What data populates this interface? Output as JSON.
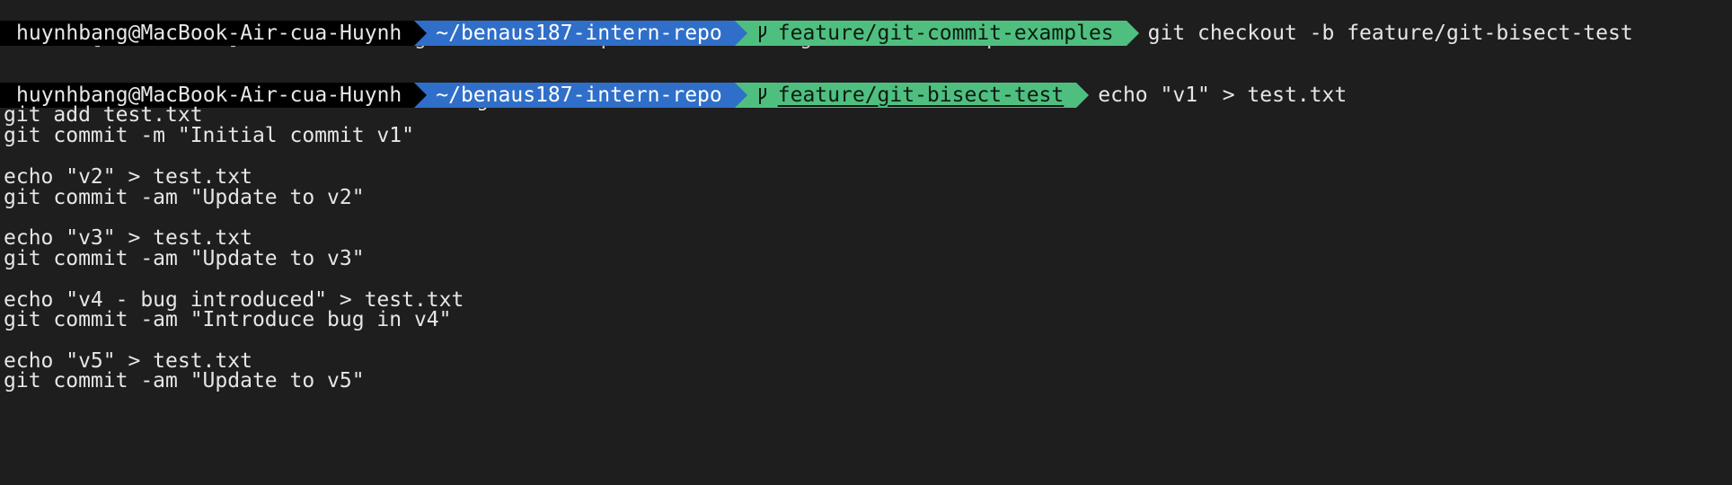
{
  "terminal": {
    "partial_top_line": "  [new branch]      feature/git-commit-examples -> feature/git-commit-examples",
    "prompt1": {
      "user": "huynhbang@MacBook-Air-cua-Huynh",
      "dir": "~/benaus187-intern-repo",
      "branch": "feature/git-commit-examples",
      "command": "git checkout -b feature/git-bisect-test"
    },
    "output1": "Switched to a new branch 'feature/git-bisect-test'",
    "prompt2": {
      "user": "huynhbang@MacBook-Air-cua-Huynh",
      "dir": "~/benaus187-intern-repo",
      "branch": "feature/git-bisect-test",
      "command": "echo \"v1\" > test.txt"
    },
    "lines": [
      "git add test.txt",
      "git commit -m \"Initial commit v1\"",
      "",
      "echo \"v2\" > test.txt",
      "git commit -am \"Update to v2\"",
      "",
      "echo \"v3\" > test.txt",
      "git commit -am \"Update to v3\"",
      "",
      "echo \"v4 - bug introduced\" > test.txt",
      "git commit -am \"Introduce bug in v4\"",
      "",
      "echo \"v5\" > test.txt",
      "git commit -am \"Update to v5\""
    ],
    "colors": {
      "background": "#1e1e1e",
      "user_segment": "#000000",
      "dir_segment": "#2f6fc9",
      "branch_segment": "#4fbf7f",
      "text": "#e6e6e6"
    },
    "icons": {
      "branch": "git-branch-icon"
    }
  }
}
